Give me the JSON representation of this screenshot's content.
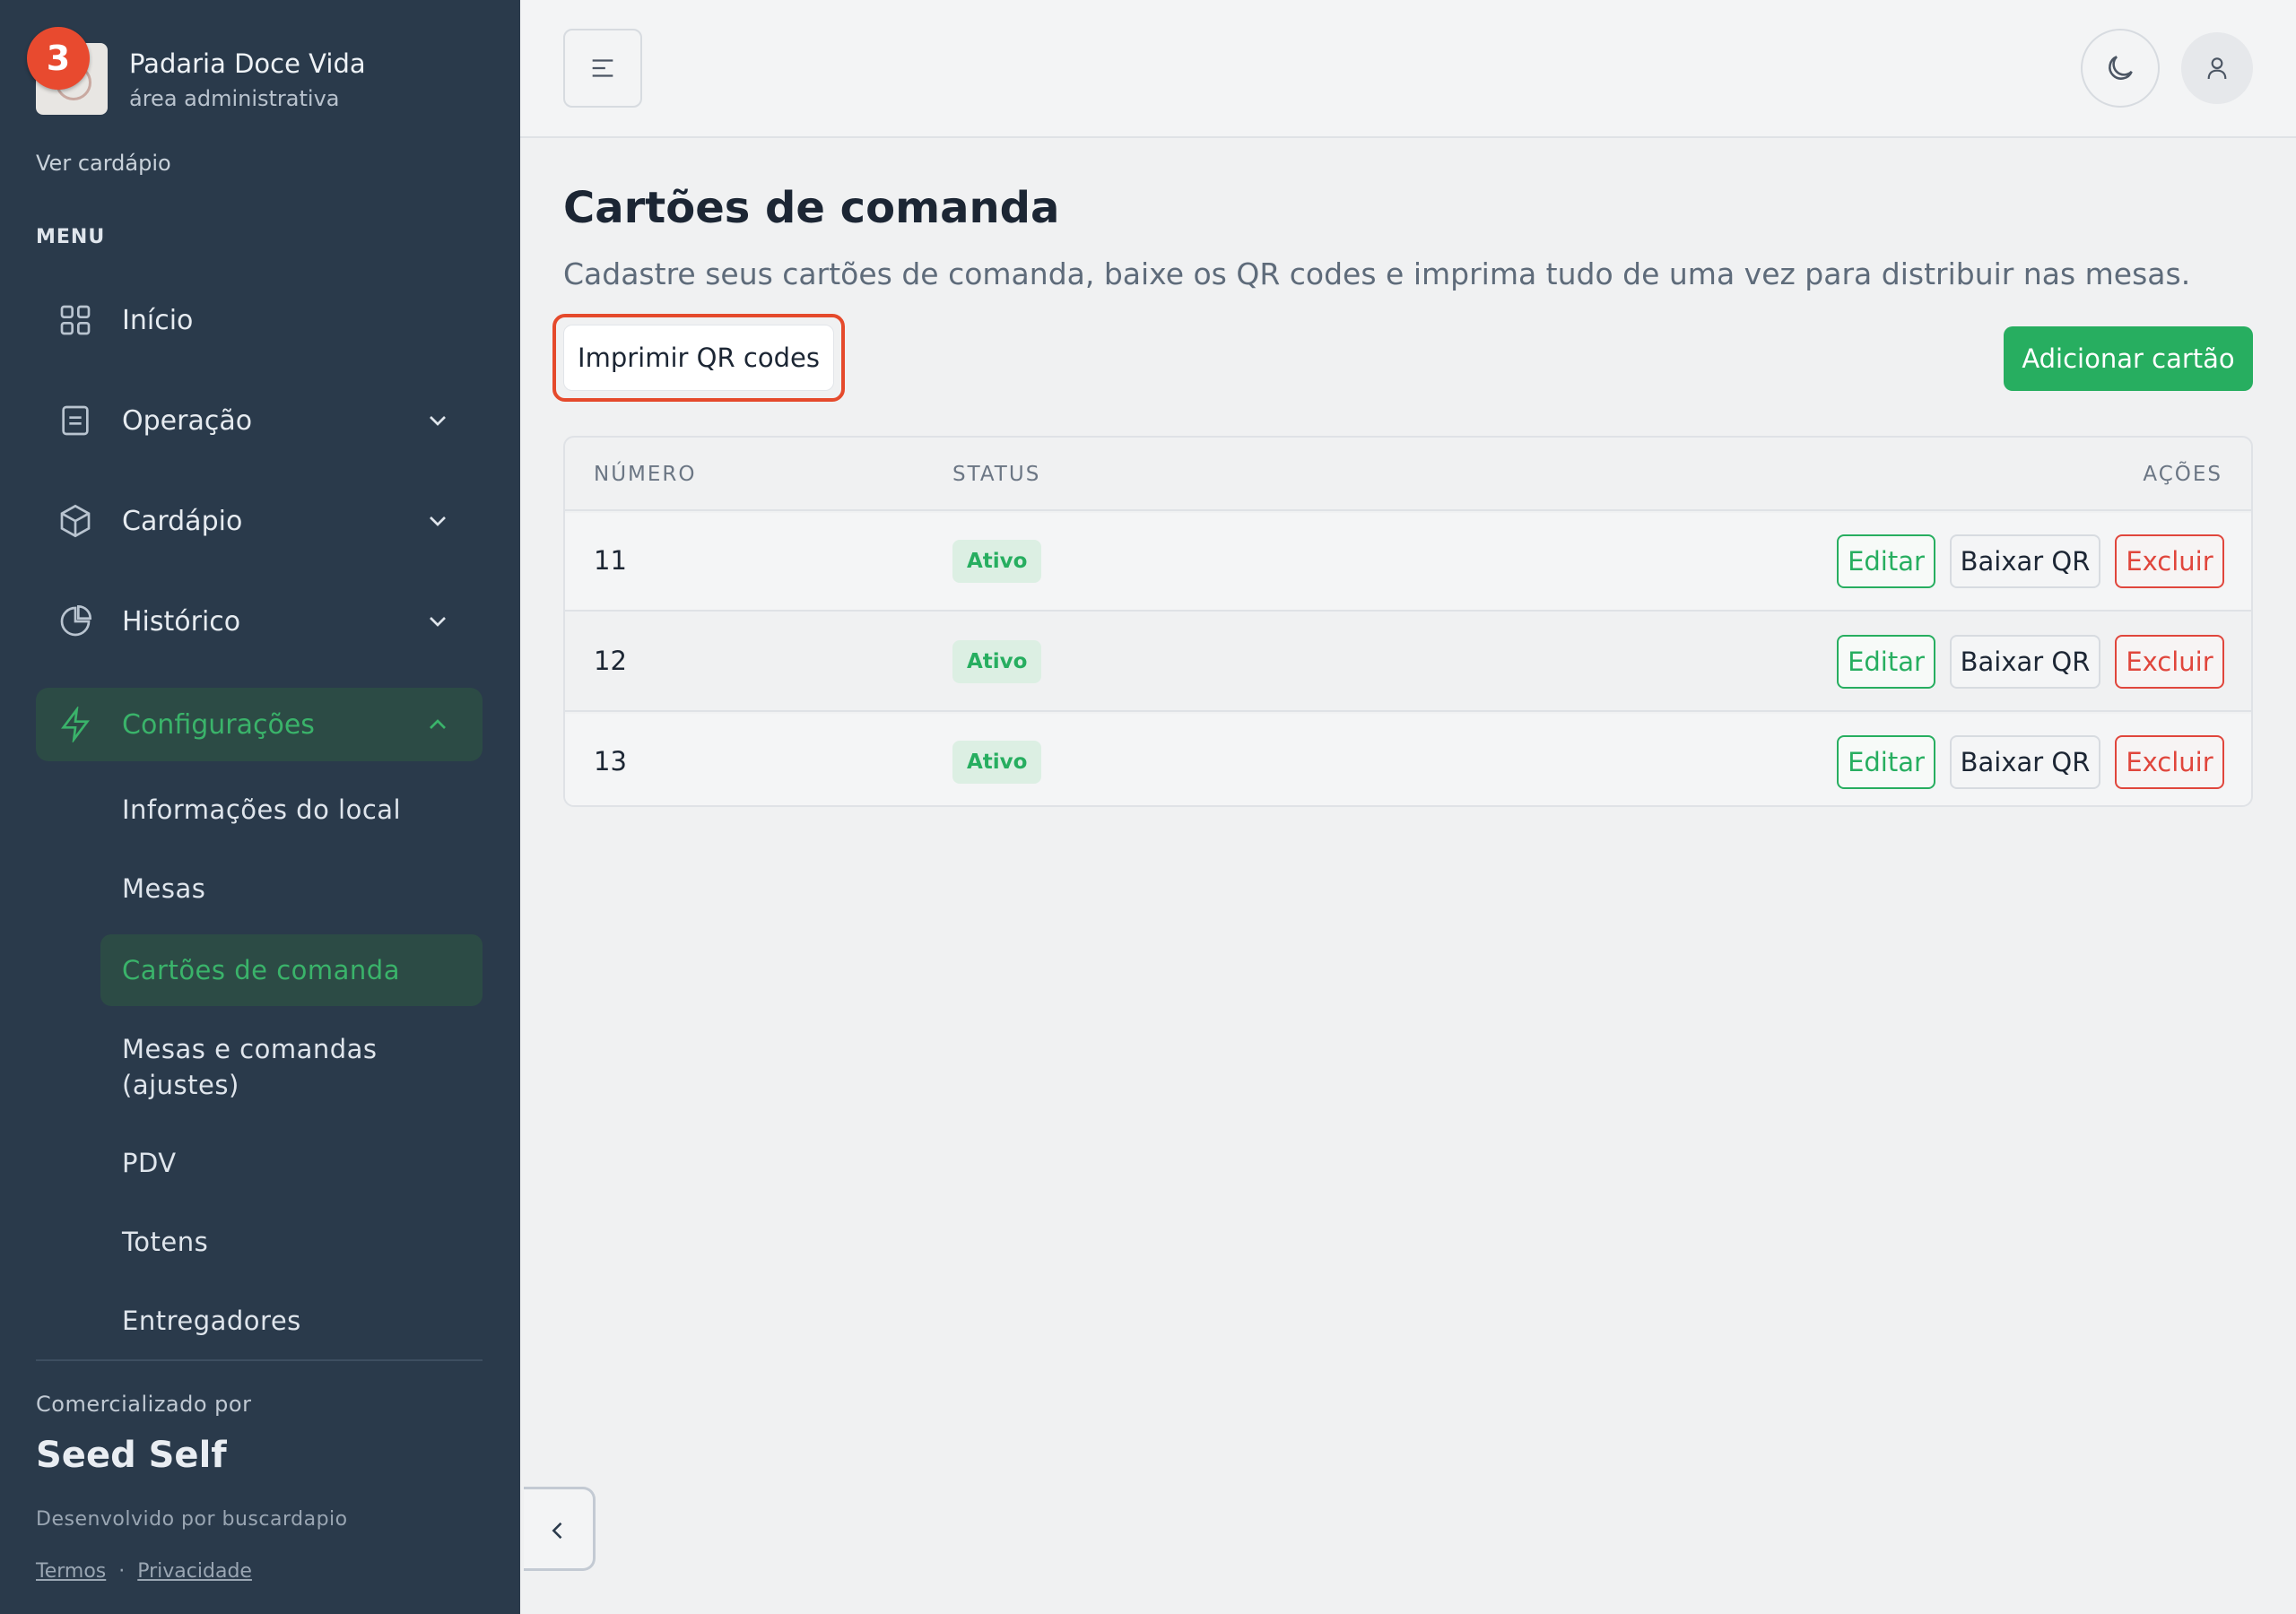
{
  "sidebar": {
    "brand": {
      "name": "Padaria Doce Vida",
      "subtitle": "área administrativa",
      "notification_count": "3"
    },
    "ver_cardapio": "Ver cardápio",
    "menu_label": "MENU",
    "items": [
      {
        "label": "Início",
        "icon": "grid-icon"
      },
      {
        "label": "Operação",
        "icon": "document-icon"
      },
      {
        "label": "Cardápio",
        "icon": "box-icon"
      },
      {
        "label": "Histórico",
        "icon": "pie-chart-icon"
      },
      {
        "label": "Configurações",
        "icon": "lightning-icon"
      }
    ],
    "sub_items": [
      {
        "label": "Informações do local"
      },
      {
        "label": "Mesas"
      },
      {
        "label": "Cartões de comanda"
      },
      {
        "label": "Mesas e comandas (ajustes)"
      },
      {
        "label": "PDV"
      },
      {
        "label": "Totens"
      },
      {
        "label": "Entregadores"
      }
    ],
    "footer": {
      "comercializado": "Comercializado por",
      "company": "Seed Self",
      "developed": "Desenvolvido por buscardapio",
      "terms": "Termos",
      "separator": "·",
      "privacy": "Privacidade"
    }
  },
  "main": {
    "title": "Cartões de comanda",
    "description": "Cadastre seus cartões de comanda, baixe os QR codes e imprima tudo de uma vez para distribuir nas mesas.",
    "print_button": "Imprimir QR codes",
    "add_button": "Adicionar cartão",
    "table": {
      "headers": {
        "number": "NÚMERO",
        "status": "STATUS",
        "actions": "AÇÕES"
      },
      "rows": [
        {
          "number": "11",
          "status": "Ativo"
        },
        {
          "number": "12",
          "status": "Ativo"
        },
        {
          "number": "13",
          "status": "Ativo"
        }
      ],
      "actions": {
        "edit": "Editar",
        "download": "Baixar QR",
        "delete": "Excluir"
      }
    }
  },
  "colors": {
    "sidebar_bg": "#2a3a4b",
    "accent_green": "#27ae60",
    "danger_red": "#e0463c",
    "highlight_outline": "#e54a2c"
  }
}
